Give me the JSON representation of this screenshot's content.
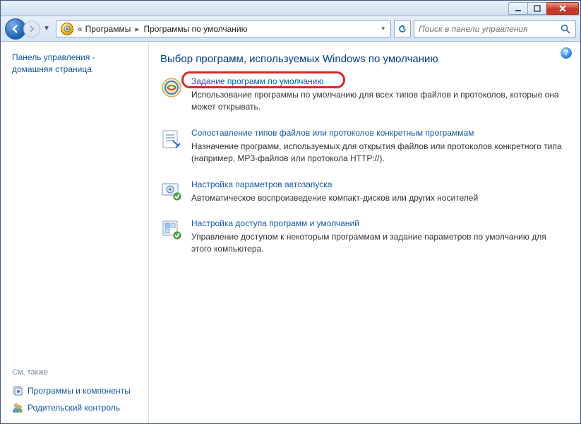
{
  "titlebar": {
    "minimize_tip": "Свернуть",
    "maximize_tip": "Развернуть",
    "close_tip": "Закрыть"
  },
  "nav": {
    "breadcrumb_prefix": "«",
    "breadcrumb1": "Программы",
    "breadcrumb2": "Программы по умолчанию",
    "search_placeholder": "Поиск в панели управления"
  },
  "sidebar": {
    "title": "Панель управления - домашняя страница",
    "see_also": "См. также",
    "link1": "Программы и компоненты",
    "link2": "Родительский контроль"
  },
  "main": {
    "title": "Выбор программ, используемых Windows по умолчанию",
    "options": [
      {
        "link": "Задание программ по умолчанию",
        "desc": "Использование программы по умолчанию для всех типов файлов и протоколов, которые она может открывать."
      },
      {
        "link": "Сопоставление типов файлов или протоколов конкретным программам",
        "desc": "Назначение программ, используемых для открытия файлов или протоколов конкретного типа (например, MP3-файлов или протокола HTTP://)."
      },
      {
        "link": "Настройка параметров автозапуска",
        "desc": "Автоматическое воспроизведение компакт-дисков или других носителей"
      },
      {
        "link": "Настройка доступа программ и умолчаний",
        "desc": "Управление доступом к некоторым программам и задание параметров по умолчанию для этого компьютера."
      }
    ]
  }
}
